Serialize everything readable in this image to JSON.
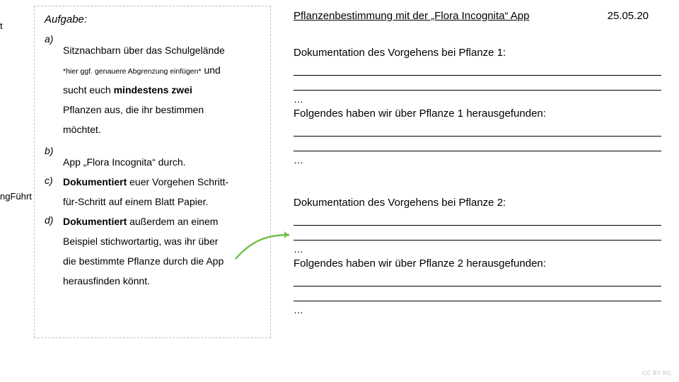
{
  "edge": {
    "t": "t",
    "f": "ngFührt"
  },
  "left": {
    "title": "Aufgabe:",
    "a_marker": "a)",
    "a_line1": "Sitznachbarn über das Schulgelände",
    "a_note": "*hier ggf. genauere Abgrenzung einfügen*",
    "a_und": " und",
    "a_line2_pre": "sucht euch ",
    "a_line2_b": "mindestens   zwei",
    "a_line3": "Pflanzen aus, die ihr bestimmen",
    "a_line4": "möchtet.",
    "b_marker": "b)",
    "b_line1": "App „Flora Incognita“ durch.",
    "c_marker": "c)",
    "c_line1_b": "Dokumentiert",
    "c_line1_rest": " euer Vorgehen Schritt-",
    "c_line2": "für-Schritt auf einem Blatt Papier.",
    "d_marker": "d)",
    "d_line1_b": "Dokumentiert",
    "d_line1_rest": " außerdem an einem",
    "d_line2": "Beispiel stichwortartig, was ihr über",
    "d_line3": "die bestimmte Pflanze durch die App",
    "d_line4": "herausfinden könnt."
  },
  "right": {
    "title": "Pflanzenbestimmung mit der „Flora Incognita“ App",
    "date": "25.05.20",
    "doc1": "Dokumentation des Vorgehens bei Pflanze 1:",
    "dots": "…",
    "found1": "Folgendes haben wir über Pflanze 1 herausgefunden:",
    "doc2": "Dokumentation des Vorgehens bei Pflanze 2:",
    "found2": "Folgendes haben wir über Pflanze 2 herausgefunden:"
  },
  "license": "CC BY NC"
}
